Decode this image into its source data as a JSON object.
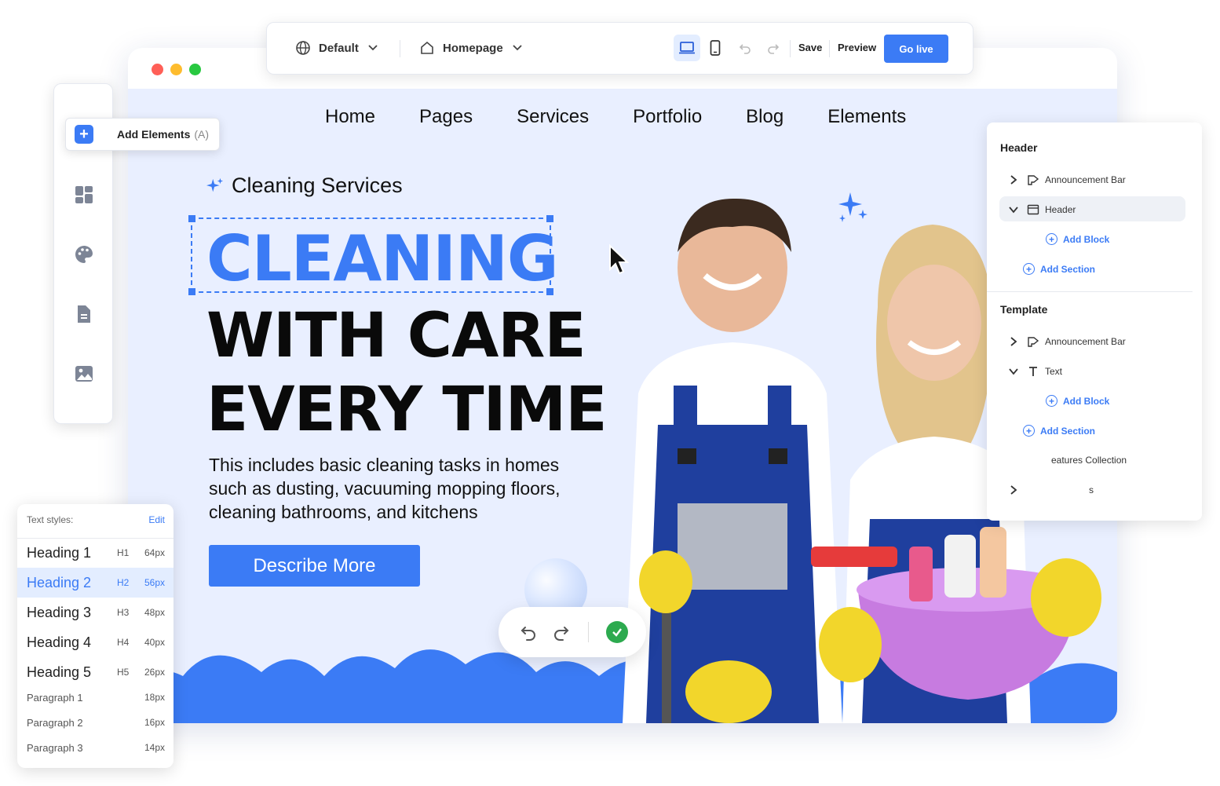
{
  "toolbar": {
    "language_label": "Default",
    "page_label": "Homepage",
    "save_label": "Save",
    "preview_label": "Preview",
    "golive_label": "Go live"
  },
  "sidebar": {
    "add_elements_label": "Add Elements",
    "add_elements_shortcut": "(A)",
    "icons": [
      "dashboard-icon",
      "palette-icon",
      "document-icon",
      "image-icon"
    ]
  },
  "site": {
    "nav": [
      "Home",
      "Pages",
      "Services",
      "Portfolio",
      "Blog",
      "Elements"
    ],
    "kicker": "Cleaning Services",
    "headline_1": "CLEANING",
    "headline_2": "WITH CARE",
    "headline_3": "EVERY TIME",
    "description": "This includes basic cleaning tasks in homes such as dusting, vacuuming mopping floors, cleaning bathrooms, and kitchens",
    "cta_label": "Describe More"
  },
  "layers_panel": {
    "header_title": "Header",
    "template_title": "Template",
    "header_items": [
      {
        "label": "Announcement Bar"
      },
      {
        "label": "Header"
      }
    ],
    "add_block": "Add Block",
    "add_section": "Add Section",
    "template_items": [
      {
        "label": "Announcement Bar"
      },
      {
        "label": "Text"
      },
      {
        "label": "eatures Collection"
      },
      {
        "label": "s"
      }
    ]
  },
  "text_styles": {
    "title": "Text styles:",
    "edit_label": "Edit",
    "rows": [
      {
        "name": "Heading 1",
        "tag": "H1",
        "size": "64px"
      },
      {
        "name": "Heading 2",
        "tag": "H2",
        "size": "56px"
      },
      {
        "name": "Heading 3",
        "tag": "H3",
        "size": "48px"
      },
      {
        "name": "Heading 4",
        "tag": "H4",
        "size": "40px"
      },
      {
        "name": "Heading 5",
        "tag": "H5",
        "size": "26px"
      },
      {
        "name": "Paragraph 1",
        "tag": "",
        "size": "18px"
      },
      {
        "name": "Paragraph 2",
        "tag": "",
        "size": "16px"
      },
      {
        "name": "Paragraph 3",
        "tag": "",
        "size": "14px"
      }
    ]
  },
  "colors": {
    "accent": "#3b7bf5",
    "canvas_bg": "#e9efff",
    "success": "#2daa4f"
  }
}
